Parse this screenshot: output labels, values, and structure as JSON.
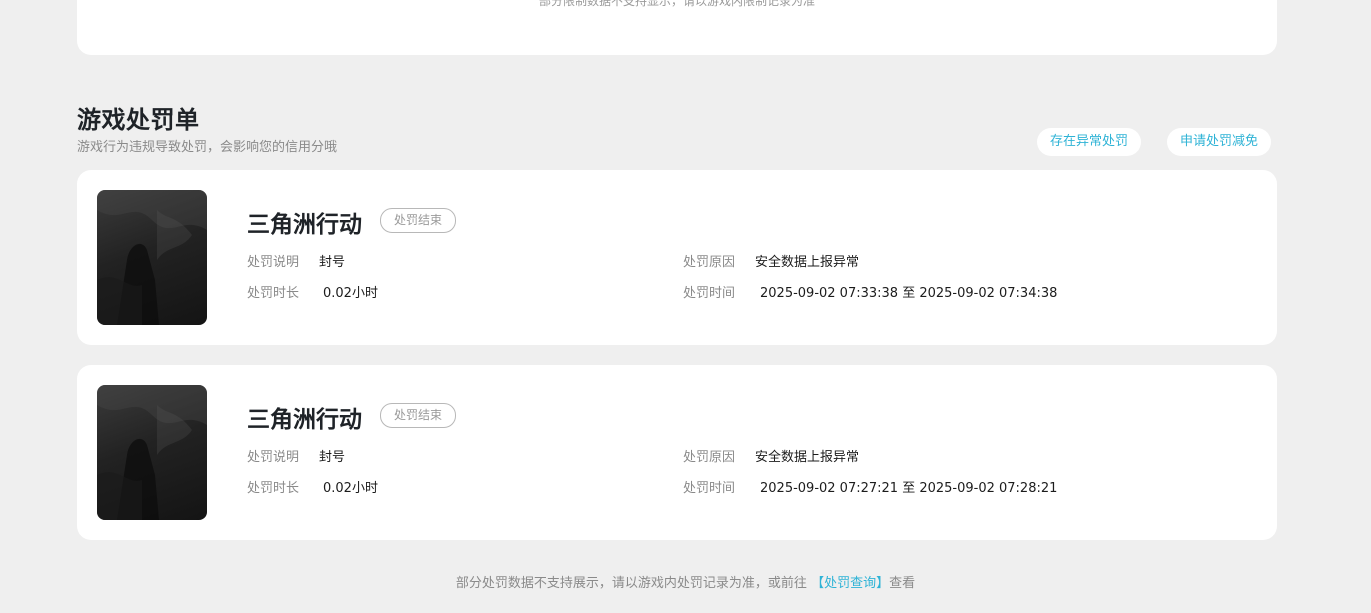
{
  "top_card": {
    "cut_note": "部分限制数据不支持显示，请以游戏内限制记录为准"
  },
  "section": {
    "title": "游戏处罚单",
    "subtitle": "游戏行为违规导致处罚，会影响您的信用分哦",
    "abnormal_button": "存在异常处罚",
    "appeal_button": "申请处罚减免"
  },
  "labels": {
    "desc": "处罚说明",
    "duration": "处罚时长",
    "reason": "处罚原因",
    "time": "处罚时间"
  },
  "records": [
    {
      "game": "三角洲行动",
      "status": "处罚结束",
      "desc": "封号",
      "duration": "0.02小时",
      "reason": "安全数据上报异常",
      "time": "2025-09-02 07:33:38 至 2025-09-02 07:34:38"
    },
    {
      "game": "三角洲行动",
      "status": "处罚结束",
      "desc": "封号",
      "duration": "0.02小时",
      "reason": "安全数据上报异常",
      "time": "2025-09-02 07:27:21 至 2025-09-02 07:28:21"
    }
  ],
  "footer": {
    "prefix": "部分处罚数据不支持展示，请以游戏内处罚记录为准，或前往",
    "link": "【处罚查询】",
    "suffix": "查看"
  },
  "colors": {
    "accent": "#2fb3d6",
    "page_bg": "#efefef",
    "card_bg": "#ffffff"
  }
}
